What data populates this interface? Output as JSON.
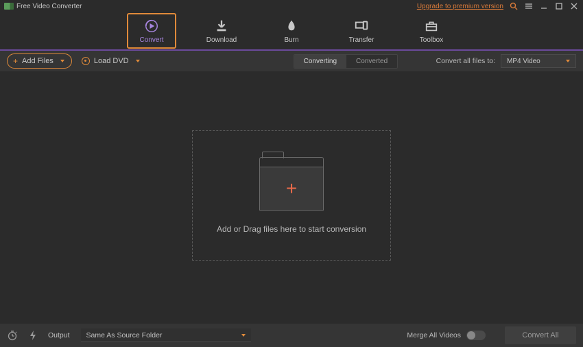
{
  "titlebar": {
    "app_name": "Free Video Converter",
    "upgrade_label": "Upgrade to premium version"
  },
  "nav": {
    "items": [
      {
        "label": "Convert"
      },
      {
        "label": "Download"
      },
      {
        "label": "Burn"
      },
      {
        "label": "Transfer"
      },
      {
        "label": "Toolbox"
      }
    ]
  },
  "toolbar": {
    "add_files": "Add Files",
    "load_dvd": "Load DVD",
    "segments": {
      "converting": "Converting",
      "converted": "Converted"
    },
    "convert_all_to_label": "Convert all files to:",
    "format_value": "MP4 Video"
  },
  "drop": {
    "text": "Add or Drag files here to start conversion"
  },
  "footer": {
    "output_label": "Output",
    "output_value": "Same As Source Folder",
    "merge_label": "Merge All Videos",
    "convert_all": "Convert All"
  }
}
